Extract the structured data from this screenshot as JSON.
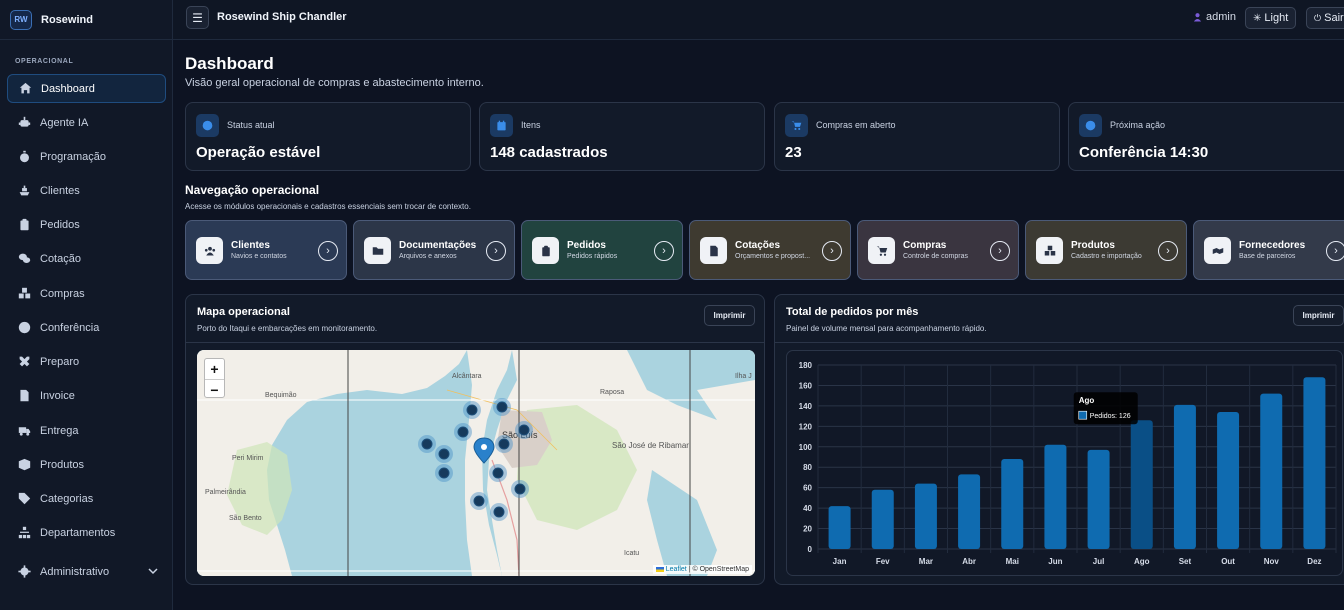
{
  "brand": {
    "logo": "RW",
    "name": "Rosewind"
  },
  "sidebar": {
    "section": "OPERACIONAL",
    "items": [
      {
        "label": "Dashboard",
        "icon": "home-icon"
      },
      {
        "label": "Agente IA",
        "icon": "robot-icon"
      },
      {
        "label": "Programação",
        "icon": "stopwatch-icon"
      },
      {
        "label": "Clientes",
        "icon": "ship-icon"
      },
      {
        "label": "Pedidos",
        "icon": "clipboard-icon"
      },
      {
        "label": "Cotação",
        "icon": "comments-icon"
      },
      {
        "label": "Compras",
        "icon": "boxes-icon"
      },
      {
        "label": "Conferência",
        "icon": "check-circle-icon"
      },
      {
        "label": "Preparo",
        "icon": "tools-icon"
      },
      {
        "label": "Invoice",
        "icon": "invoice-icon"
      },
      {
        "label": "Entrega",
        "icon": "truck-icon"
      },
      {
        "label": "Produtos",
        "icon": "box-icon"
      },
      {
        "label": "Categorias",
        "icon": "tag-icon"
      },
      {
        "label": "Departamentos",
        "icon": "sitemap-icon"
      },
      {
        "label": "Administrativo",
        "icon": "gear-icon"
      }
    ]
  },
  "topbar": {
    "title": "Rosewind Ship Chandler",
    "user": "admin",
    "theme_btn": "Light",
    "logout_btn": "Sair"
  },
  "page": {
    "title": "Dashboard",
    "subtitle": "Visão geral operacional de compras e abastecimento interno."
  },
  "stats": [
    {
      "label": "Status atual",
      "value": "Operação estável",
      "icon": "circle-icon"
    },
    {
      "label": "Itens",
      "value": "148 cadastrados",
      "icon": "calendar-icon"
    },
    {
      "label": "Compras em aberto",
      "value": "23",
      "icon": "cart-icon"
    },
    {
      "label": "Próxima ação",
      "value": "Conferência 14:30",
      "icon": "clock-icon"
    }
  ],
  "nav_section": {
    "title": "Navegação operacional",
    "subtitle": "Acesse os módulos operacionais e cadastros essenciais sem trocar de contexto."
  },
  "nav_cards": [
    {
      "title": "Clientes",
      "sub": "Navios e contatos",
      "icon": "users-icon",
      "color": "#2b3a55"
    },
    {
      "title": "Documentações",
      "sub": "Arquivos e anexos",
      "icon": "folder-icon",
      "color": "#2c3648"
    },
    {
      "title": "Pedidos",
      "sub": "Pedidos rápidos",
      "icon": "clipboard-icon",
      "color": "#21433f"
    },
    {
      "title": "Cotações",
      "sub": "Orçamentos e propost...",
      "icon": "file-icon",
      "color": "#3e3a30"
    },
    {
      "title": "Compras",
      "sub": "Controle de compras",
      "icon": "cart-icon",
      "color": "#3a3540"
    },
    {
      "title": "Produtos",
      "sub": "Cadastro e importação",
      "icon": "boxes-icon",
      "color": "#3c3a33"
    },
    {
      "title": "Fornecedores",
      "sub": "Base de parceiros",
      "icon": "handshake-icon",
      "color": "#333a4a"
    }
  ],
  "map_panel": {
    "title": "Mapa operacional",
    "subtitle": "Porto do Itaqui e embarcações em monitoramento.",
    "print": "Imprimir",
    "labels": [
      "Alcântara",
      "Bequimão",
      "Peri Mirim",
      "Palmeirândia",
      "São Bento",
      "Raposa",
      "São Luís",
      "São José de Ribamar",
      "Icatu",
      "Ilha J"
    ],
    "attribution_link": "Leaflet",
    "attribution_rest": "| © OpenStreetMap"
  },
  "chart_panel": {
    "title": "Total de pedidos por mês",
    "subtitle": "Painel de volume mensal para acompanhamento rápido.",
    "print": "Imprimir",
    "tooltip_title": "Ago",
    "tooltip_text": "Pedidos: 126"
  },
  "chart_data": {
    "type": "bar",
    "categories": [
      "Jan",
      "Fev",
      "Mar",
      "Abr",
      "Mai",
      "Jun",
      "Jul",
      "Ago",
      "Set",
      "Out",
      "Nov",
      "Dez"
    ],
    "series": [
      {
        "name": "Pedidos",
        "values": [
          42,
          58,
          64,
          73,
          88,
          102,
          97,
          126,
          141,
          134,
          152,
          168
        ]
      }
    ],
    "yticks": [
      0,
      20,
      40,
      60,
      80,
      100,
      120,
      140,
      160,
      180
    ],
    "ylim": [
      0,
      180
    ],
    "highlight_index": 7,
    "bar_color": "#0f6bb0",
    "highlight_color": "#0a4f86"
  }
}
